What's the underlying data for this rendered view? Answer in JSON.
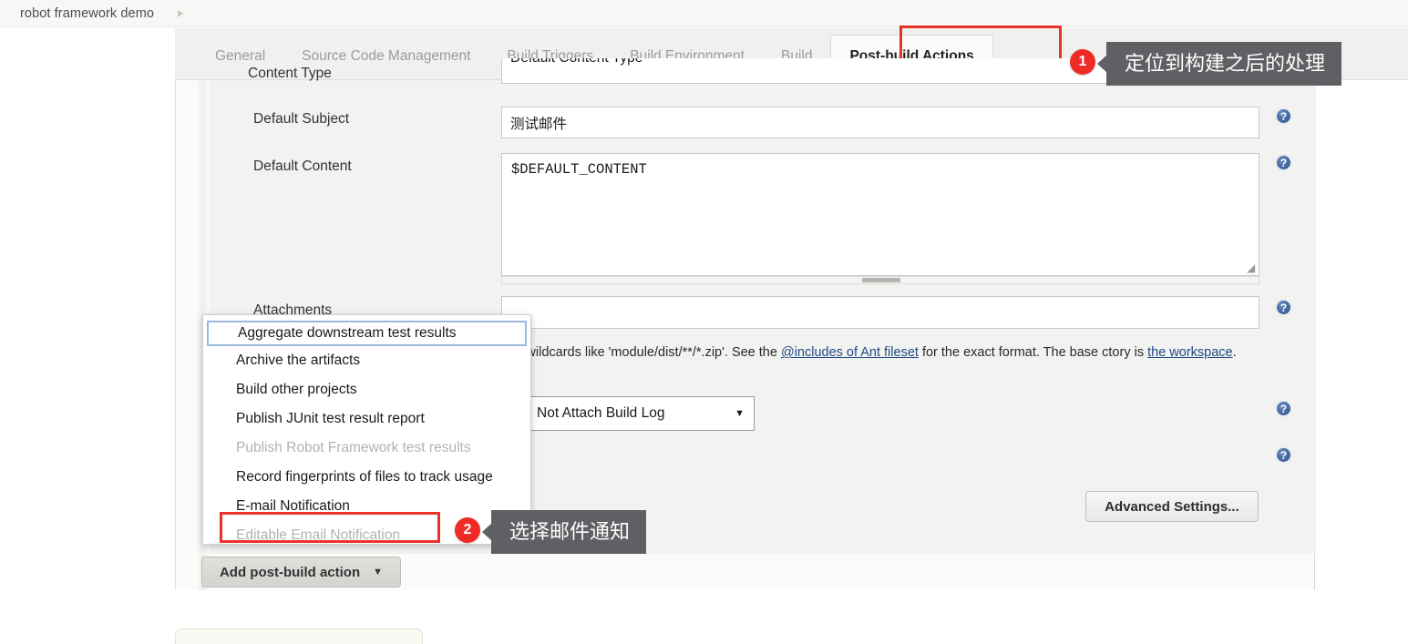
{
  "breadcrumb": {
    "project": "robot framework demo",
    "caret_icon": "caret-right-icon"
  },
  "tabs": [
    {
      "label": "General",
      "active": false
    },
    {
      "label": "Source Code Management",
      "active": false
    },
    {
      "label": "Build Triggers",
      "active": false
    },
    {
      "label": "Build Environment",
      "active": false
    },
    {
      "label": "Build",
      "active": false
    },
    {
      "label": "Post-build Actions",
      "active": true
    }
  ],
  "form": {
    "content_type": {
      "label": "Content Type",
      "value": "Default Content Type"
    },
    "default_subject": {
      "label": "Default Subject",
      "value": "测试邮件"
    },
    "default_content": {
      "label": "Default Content",
      "value": "$DEFAULT_CONTENT"
    },
    "attachments": {
      "label": "Attachments",
      "value": ""
    },
    "help_text": {
      "part1": "use wildcards like 'module/dist/**/*.zip'. See the ",
      "link1": "@includes of Ant fileset",
      "part2": " for the exact format. The base ",
      "part3": "ctory is ",
      "link2": "the workspace",
      "part4": "."
    },
    "build_log_select": {
      "value": "Not Attach Build Log",
      "caret_icon": "chevron-down-icon"
    },
    "help_icon_label": "?"
  },
  "buttons": {
    "advanced_settings": "Advanced Settings...",
    "add_post_build_action": "Add post-build action",
    "add_action_caret_icon": "caret-down-icon"
  },
  "dropdown": {
    "items": [
      {
        "label": "Aggregate downstream test results",
        "state": "selected"
      },
      {
        "label": "Archive the artifacts",
        "state": "enabled"
      },
      {
        "label": "Build other projects",
        "state": "enabled"
      },
      {
        "label": "Publish JUnit test result report",
        "state": "enabled"
      },
      {
        "label": "Publish Robot Framework test results",
        "state": "disabled"
      },
      {
        "label": "Record fingerprints of files to track usage",
        "state": "enabled"
      },
      {
        "label": "E-mail Notification",
        "state": "enabled"
      },
      {
        "label": "Editable Email Notification",
        "state": "disabled"
      }
    ]
  },
  "annotations": [
    {
      "number": "1",
      "text": "定位到构建之后的处理"
    },
    {
      "number": "2",
      "text": "选择邮件通知"
    }
  ],
  "colors": {
    "highlight_red": "#e8322a",
    "badge_red": "#ee2b26",
    "tooltip_grey": "#5e6063",
    "link_blue": "#204a87"
  }
}
